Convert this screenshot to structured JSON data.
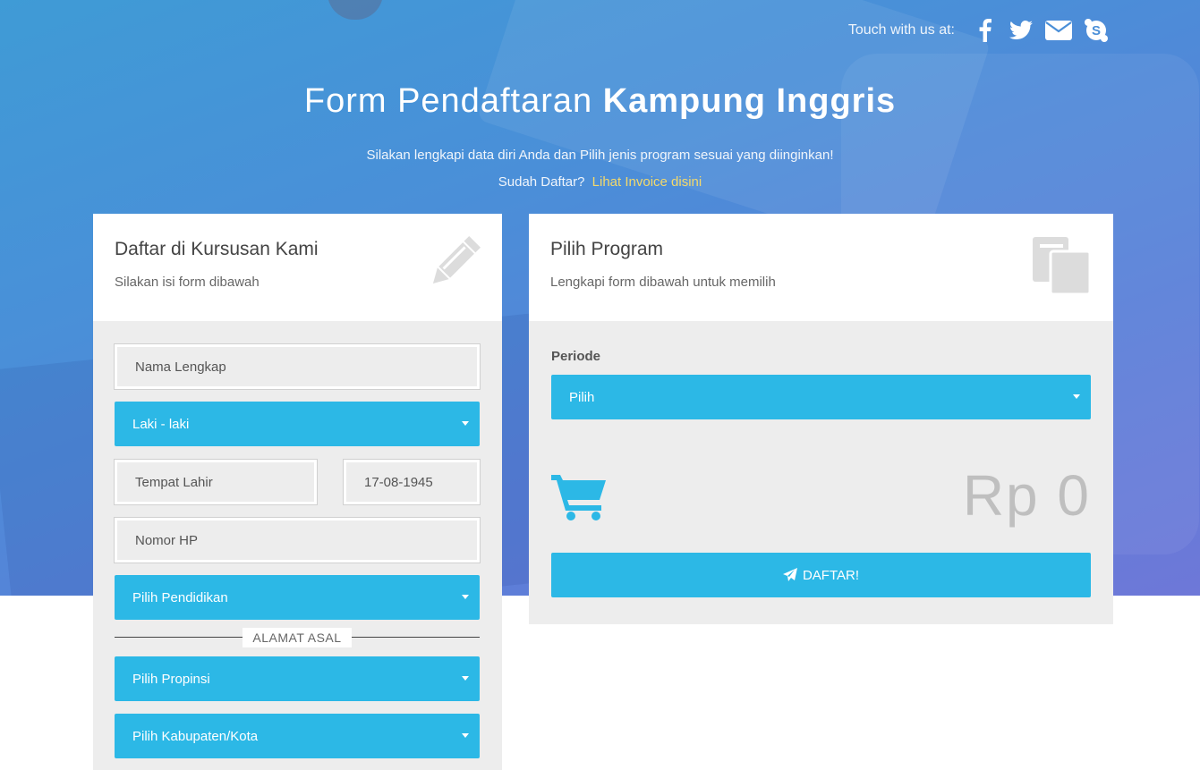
{
  "header": {
    "touch_label": "Touch with us at:",
    "social_icons": [
      "facebook-icon",
      "twitter-icon",
      "envelope-icon",
      "skype-icon"
    ],
    "title_light": "Form Pendaftaran",
    "title_bold": "Kampung Inggris",
    "subtitle": "Silakan lengkapi data diri Anda dan Pilih jenis program sesuai yang diinginkan!",
    "already_text": "Sudah Daftar?",
    "invoice_link": "Lihat Invoice disini"
  },
  "register_panel": {
    "title": "Daftar di Kursusan Kami",
    "subtitle": "Silakan isi form dibawah",
    "icon": "pencil-icon",
    "fields": {
      "nama_placeholder": "Nama Lengkap",
      "gender_selected": "Laki - laki",
      "tempat_lahir_placeholder": "Tempat Lahir",
      "tanggal_lahir_value": "17-08-1945",
      "nomor_hp_placeholder": "Nomor HP",
      "pendidikan_selected": "Pilih Pendidikan",
      "alamat_section_label": "ALAMAT ASAL",
      "propinsi_selected": "Pilih Propinsi",
      "kabupaten_selected": "Pilih Kabupaten/Kota"
    }
  },
  "program_panel": {
    "title": "Pilih Program",
    "subtitle": "Lengkapi form dibawah untuk memilih",
    "icon": "copy-icon",
    "periode_label": "Periode",
    "periode_selected": "Pilih",
    "price": "Rp 0",
    "cart_icon": "shopping-cart-icon",
    "submit_label": "DAFTAR!"
  },
  "colors": {
    "accent": "#2cb8e6",
    "link": "#f3d96b",
    "panel_bg": "#ededed"
  }
}
